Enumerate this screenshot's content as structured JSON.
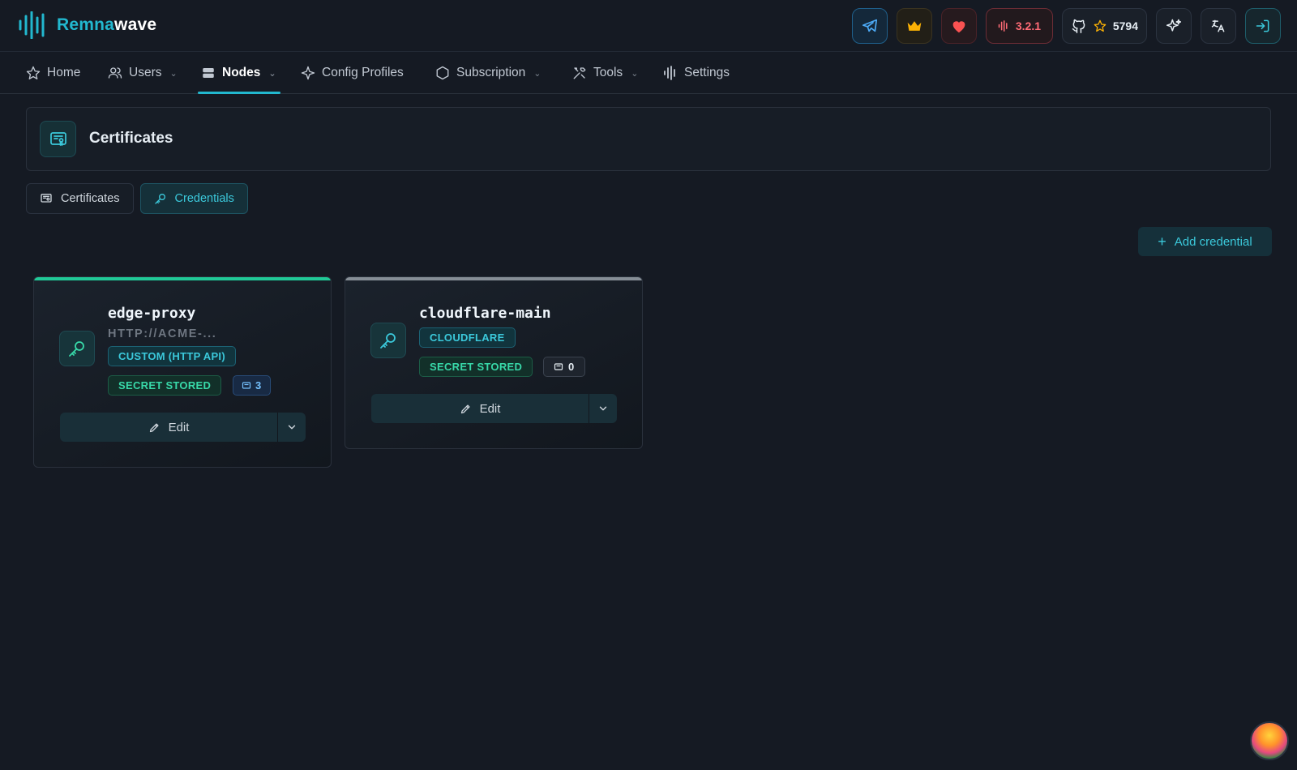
{
  "header": {
    "brand_part1": "Remna",
    "brand_part2": "wave",
    "version": "3.2.1",
    "github_stars": "5794"
  },
  "nav": {
    "home": "Home",
    "users": "Users",
    "nodes": "Nodes",
    "config_profiles": "Config Profiles",
    "subscription": "Subscription",
    "tools": "Tools",
    "settings": "Settings"
  },
  "page": {
    "title": "Certificates"
  },
  "tabs": {
    "certificates": "Certificates",
    "credentials": "Credentials"
  },
  "actions": {
    "add_credential": "Add credential"
  },
  "credentials": [
    {
      "name": "edge-proxy",
      "url": "HTTP://ACME-...",
      "type": "CUSTOM (HTTP API)",
      "secret": "SECRET STORED",
      "cert_count": "3",
      "edit_label": "Edit"
    },
    {
      "name": "cloudflare-main",
      "type": "CLOUDFLARE",
      "secret": "SECRET STORED",
      "cert_count": "0",
      "edit_label": "Edit"
    }
  ],
  "colors": {
    "accent": "#22b8cf",
    "background": "#151a23",
    "secret_green": "#38d9a9",
    "card_top_active": "#20c997",
    "card_top_inactive": "#868e96"
  }
}
